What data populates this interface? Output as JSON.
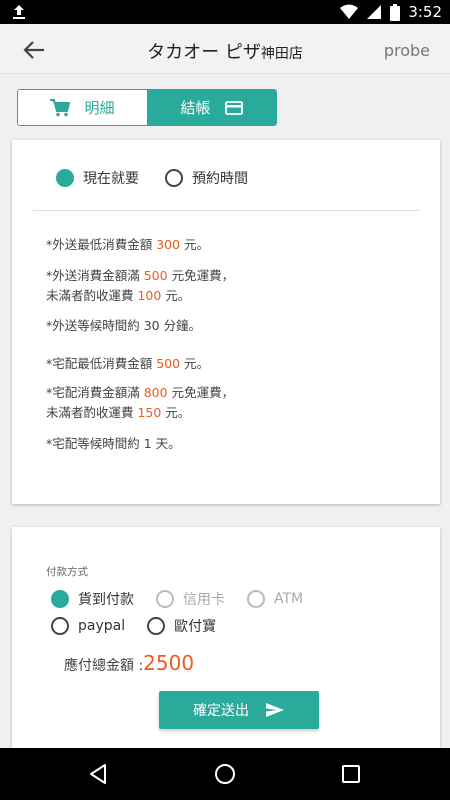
{
  "status_bar": {
    "time": "3:52",
    "icons": [
      "upload-icon",
      "wifi-icon",
      "signal-icon",
      "battery-icon"
    ]
  },
  "app_bar": {
    "title_main": "タカオー ピザ",
    "title_sub": "神田店",
    "right_text": "probe"
  },
  "tabs": [
    {
      "label": "明細",
      "icon": "cart-icon",
      "selected": false
    },
    {
      "label": "結帳",
      "icon": "credit-card-icon",
      "selected": true
    }
  ],
  "delivery_time": {
    "options": [
      {
        "label": "現在就要",
        "selected": true
      },
      {
        "label": "預約時間",
        "selected": false
      }
    ]
  },
  "rules": {
    "r1": {
      "a": "*外送最低消費金額 ",
      "v": "300",
      "b": " 元。"
    },
    "r2": {
      "a": "*外送消費金額滿 ",
      "v": "500",
      "b": " 元免運費，"
    },
    "r2b": {
      "a": "未滿者酌收運費 ",
      "v": "100",
      "b": " 元。"
    },
    "r3": {
      "a": "*外送等候時間約 ",
      "v": "30",
      "b": " 分鐘。"
    },
    "r4": {
      "a": "*宅配最低消費金額 ",
      "v": "500",
      "b": " 元。"
    },
    "r5": {
      "a": "*宅配消費金額滿 ",
      "v": "800",
      "b": " 元免運費，"
    },
    "r5b": {
      "a": "未滿者酌收運費 ",
      "v": "150",
      "b": " 元。"
    },
    "r6": {
      "a": "*宅配等候時間約 ",
      "v": "1",
      "b": " 天。"
    }
  },
  "payment": {
    "label": "付款方式",
    "options": [
      {
        "label": "貨到付款",
        "selected": true,
        "enabled": true
      },
      {
        "label": "信用卡",
        "selected": false,
        "enabled": false
      },
      {
        "label": "ATM",
        "selected": false,
        "enabled": false
      },
      {
        "label": "paypal",
        "selected": false,
        "enabled": true
      },
      {
        "label": "歐付寶",
        "selected": false,
        "enabled": true
      }
    ],
    "total_label": "應付總金額 : ",
    "total_amount": "2500",
    "submit_label": "確定送出"
  },
  "colors": {
    "accent": "#2aaa9a",
    "highlight": "#f15a22"
  }
}
